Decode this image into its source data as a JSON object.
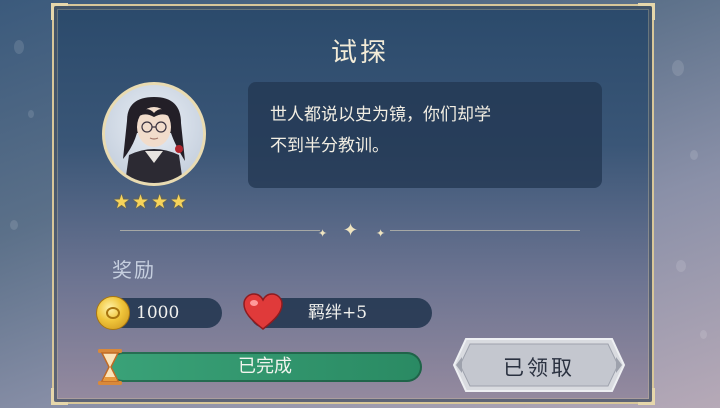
{
  "task": {
    "title": "试探",
    "dialog": [
      "世人都说以史为镜，你们却学",
      "不到半分教训。"
    ],
    "star_count": 4,
    "stars_max": 4
  },
  "rewards": {
    "label": "奖励",
    "coin_amount": "1000",
    "bond_text": "羁绊+5"
  },
  "status": {
    "progress_label": "已完成",
    "progress_fraction": 1.0,
    "claim_button_label": "已领取"
  },
  "icons": {
    "coin": "gold-coin-icon",
    "heart": "heart-icon",
    "hourglass": "hourglass-icon",
    "star": "star-icon"
  },
  "colors": {
    "panel_border": "#d8c79a",
    "title_text": "#f3ecd8",
    "star": "#f6d35a",
    "progress_fill": "#2a8a63",
    "heart": "#e03a3a"
  }
}
